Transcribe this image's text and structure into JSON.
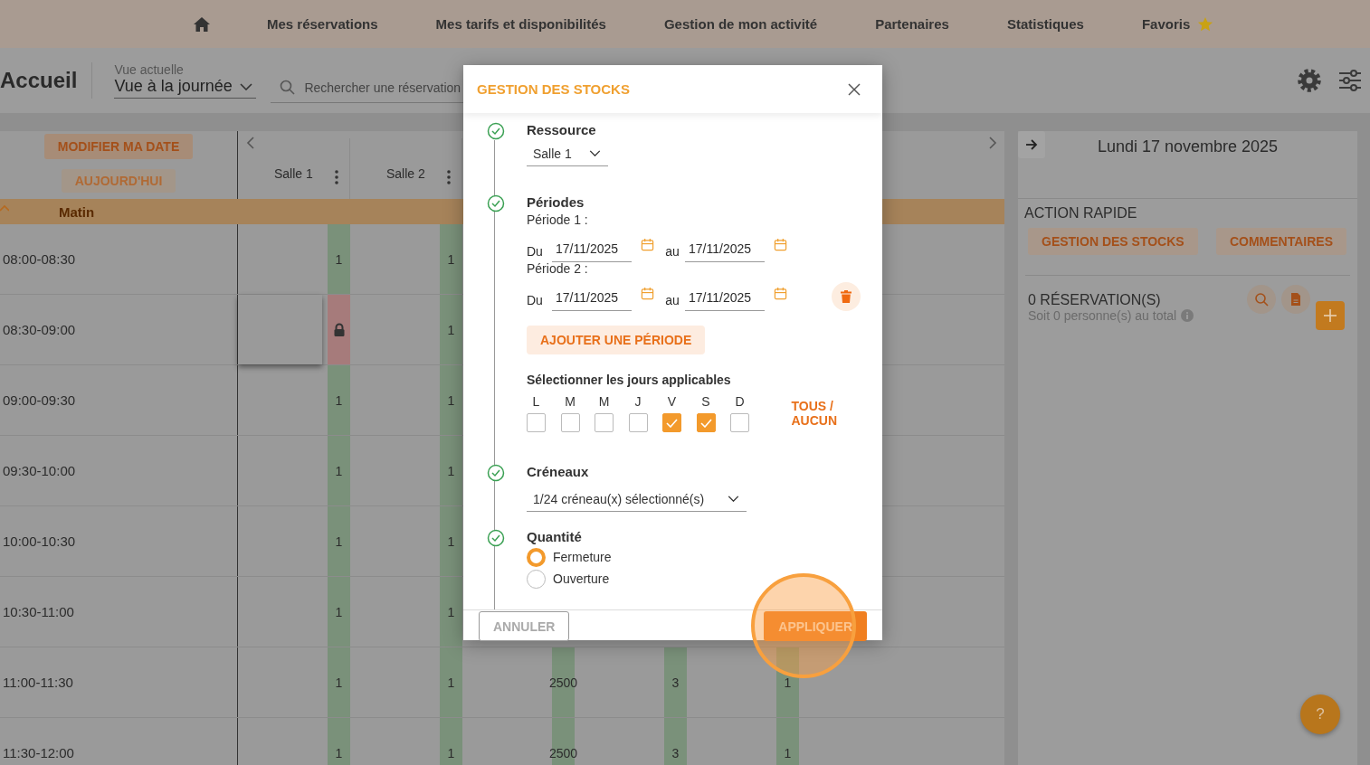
{
  "nav": {
    "items": [
      {
        "kind": "home"
      },
      {
        "kind": "link",
        "label": "Mes réservations"
      },
      {
        "kind": "link",
        "label": "Mes tarifs et disponibilités"
      },
      {
        "kind": "link",
        "label": "Gestion de mon activité"
      },
      {
        "kind": "link",
        "label": "Partenaires"
      },
      {
        "kind": "link",
        "label": "Statistiques"
      },
      {
        "kind": "favorites",
        "label": "Favoris"
      }
    ]
  },
  "toolbar": {
    "title": "Accueil",
    "view_label": "Vue actuelle",
    "view_value": "Vue à la journée",
    "search_placeholder": "Rechercher une réservation"
  },
  "calendar": {
    "buttons": [
      "MODIFIER MA DATE",
      "AUJOURD'HUI"
    ],
    "resources": [
      "Salle 1",
      "Salle 2"
    ],
    "period": "Matin",
    "rows": [
      {
        "time": "08:00-08:30",
        "cells": [
          {
            "kind": "available",
            "value": "1"
          },
          {
            "kind": "available",
            "value": "1"
          }
        ]
      },
      {
        "time": "08:30-09:00",
        "cells": [
          {
            "kind": "locked",
            "hovered": true
          },
          {
            "kind": "available",
            "value": "1"
          }
        ]
      },
      {
        "time": "09:00-09:30",
        "cells": [
          {
            "kind": "available",
            "value": "1"
          },
          {
            "kind": "available",
            "value": "1"
          }
        ]
      },
      {
        "time": "09:30-10:00",
        "cells": [
          {
            "kind": "available",
            "value": "1"
          },
          {
            "kind": "available",
            "value": "1"
          }
        ]
      },
      {
        "time": "10:00-10:30",
        "cells": [
          {
            "kind": "available",
            "value": "1"
          },
          {
            "kind": "available",
            "value": "1"
          }
        ]
      },
      {
        "time": "10:30-11:00",
        "cells": [
          {
            "kind": "available",
            "value": "1"
          },
          {
            "kind": "available",
            "value": "1"
          }
        ]
      },
      {
        "time": "11:00-11:30",
        "cells": [
          {
            "kind": "available",
            "value": "1"
          },
          {
            "kind": "available",
            "value": "1"
          },
          {
            "kind": "available",
            "value": "2500"
          },
          {
            "kind": "available",
            "value": "3"
          },
          {
            "kind": "available",
            "value": "1"
          }
        ]
      },
      {
        "time": "11:30-12:00",
        "cells": [
          {
            "kind": "available",
            "value": "1"
          },
          {
            "kind": "available",
            "value": "1"
          },
          {
            "kind": "available",
            "value": "2500"
          },
          {
            "kind": "available",
            "value": "3"
          },
          {
            "kind": "available",
            "value": "1"
          }
        ]
      }
    ]
  },
  "side": {
    "date": "Lundi 17 novembre 2025",
    "quick_title": "ACTION RAPIDE",
    "quick_buttons": [
      "GESTION DES STOCKS",
      "COMMENTAIRES"
    ],
    "reservations": "0 RÉSERVATION(S)",
    "summary": "Soit 0 personne(s) au total"
  },
  "help": "?",
  "modal": {
    "title": "GESTION DES STOCKS",
    "resource": {
      "title": "Ressource",
      "value": "Salle 1",
      "done": true
    },
    "periods": {
      "title": "Périodes",
      "done": true,
      "items": [
        {
          "label": "Période 1 :",
          "from_label": "Du",
          "from": "17/11/2025",
          "to_label": "au",
          "to": "17/11/2025",
          "deletable": false
        },
        {
          "label": "Période 2 :",
          "from_label": "Du",
          "from": "17/11/2025",
          "to_label": "au",
          "to": "17/11/2025",
          "deletable": true
        }
      ],
      "add_button": "AJOUTER UNE PÉRIODE"
    },
    "days": {
      "title": "Sélectionner les jours applicables",
      "items": [
        {
          "label": "L",
          "checked": false
        },
        {
          "label": "M",
          "checked": false
        },
        {
          "label": "M",
          "checked": false
        },
        {
          "label": "J",
          "checked": false
        },
        {
          "label": "V",
          "checked": true
        },
        {
          "label": "S",
          "checked": true
        },
        {
          "label": "D",
          "checked": false
        }
      ],
      "toggle_all": "TOUS / AUCUN"
    },
    "slots": {
      "title": "Créneaux",
      "value": "1/24 créneau(x) sélectionné(s)",
      "done": true
    },
    "quantity": {
      "title": "Quantité",
      "done": true,
      "options": [
        {
          "label": "Fermeture",
          "selected": true
        },
        {
          "label": "Ouverture",
          "selected": false
        }
      ]
    },
    "footer": {
      "cancel": "ANNULER",
      "apply": "APPLIQUER",
      "apply_highlighted": true
    }
  }
}
